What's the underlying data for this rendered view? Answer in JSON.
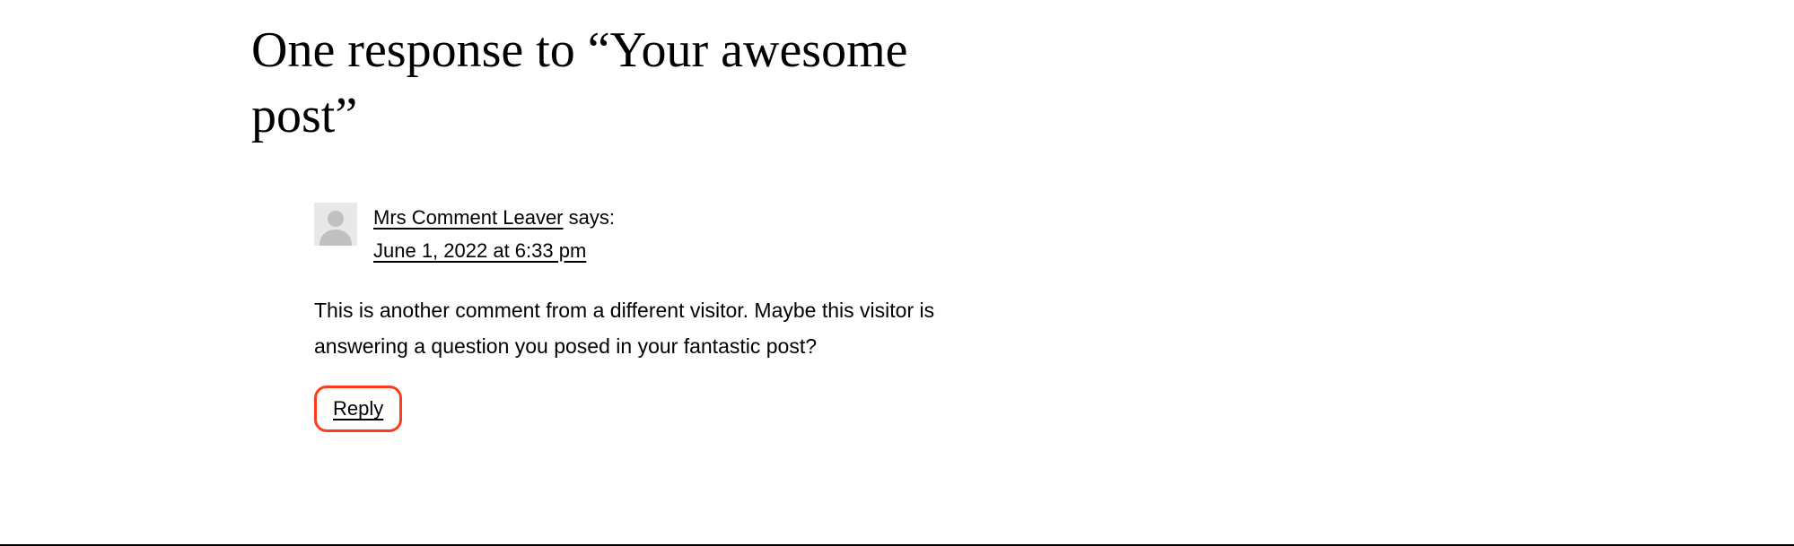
{
  "heading": "One response to “Your awesome post”",
  "comment": {
    "author": "Mrs Comment Leaver",
    "says": " says:",
    "date": "June 1, 2022 at 6:33 pm",
    "body": "This is another comment from a different visitor. Maybe this visitor is answering a question you posed in your fantastic post?",
    "reply": "Reply"
  }
}
